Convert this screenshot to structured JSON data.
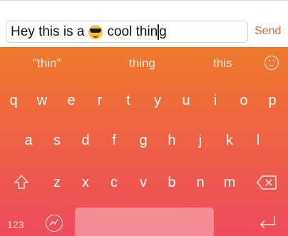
{
  "message": {
    "text_before": "Hey this is a",
    "emoji": "sunglasses-emoji",
    "text_middle": "cool thin",
    "text_after": "g"
  },
  "send_label": "Send",
  "suggestions": [
    "\"thin\"",
    "thing",
    "this"
  ],
  "rows": [
    [
      "q",
      "w",
      "e",
      "r",
      "t",
      "y",
      "u",
      "i",
      "o",
      "p"
    ],
    [
      "a",
      "s",
      "d",
      "f",
      "g",
      "h",
      "j",
      "k",
      "l"
    ],
    [
      "z",
      "x",
      "c",
      "v",
      "b",
      "n",
      "m"
    ]
  ],
  "numbers_label": "123",
  "colors": {
    "accent": "#e8692b",
    "gradient_top": "#ee7a2c",
    "gradient_bottom": "#ee4b5e"
  }
}
